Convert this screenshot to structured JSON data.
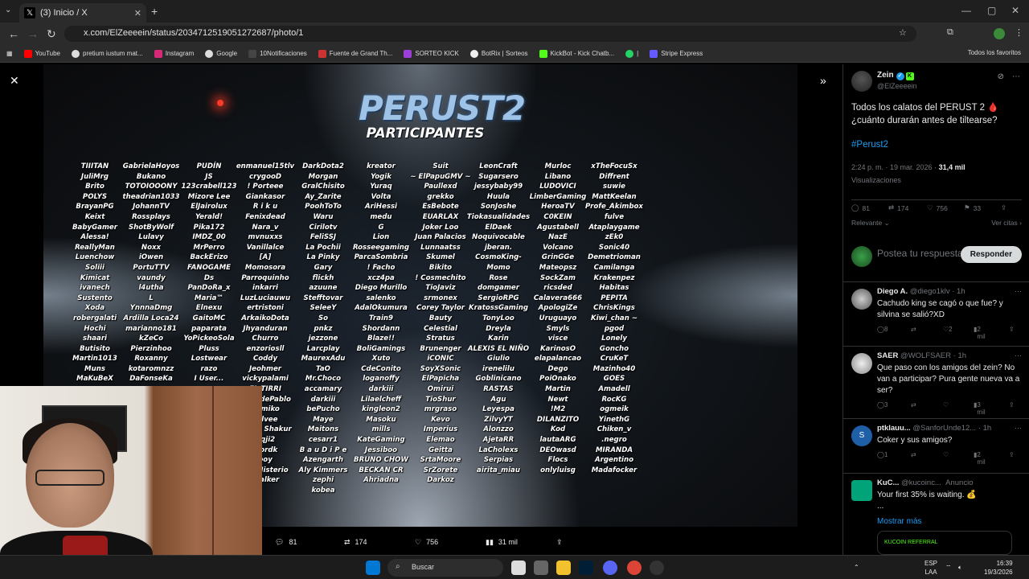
{
  "browser": {
    "tab_title": "(3) Inicio / X",
    "url": "x.com/ElZeeeein/status/2034712519051272687/photo/1",
    "bookmarks": [
      "YouTube",
      "pretium iustum mat...",
      "Instagram",
      "Google",
      "10Notificaciones",
      "Fuente de Grand Th...",
      "SORTEO KICK",
      "BotRix | Sorteos",
      "KickBot - Kick Chatb...",
      "|",
      "Stripe Express"
    ],
    "bookmarks_right": "Todos los favoritos"
  },
  "poster": {
    "title": "PERUST2",
    "subtitle": "PARTICIPANTES",
    "columns": [
      [
        "TIIITAN",
        "JuliMrg",
        "Brito",
        "POLYS",
        "BrayanPG",
        "Keixt",
        "BabyGamer",
        "Alessa!",
        "ReallyMan",
        "Luenchow",
        "Soliii",
        "Kimicat",
        "ivanech",
        "Sustento",
        "Xoda",
        "robergalati",
        "Hochi",
        "shaari",
        "Butisito",
        "Martin1013",
        "Muns",
        "MaKuBeX"
      ],
      [
        "GabrielaHoyos",
        "Bukano",
        "TOTOIOOONY",
        "theadrian1033",
        "JohannTV",
        "Rossplays",
        "ShotByWolf",
        "Lulavy",
        "Noxx",
        "iOwen",
        "PortuTTV",
        "vaundy",
        "l4utha",
        "L",
        "YnnnaDmg",
        "Ardilla Loca24",
        "marianno181",
        "kZeCo",
        "Pierzinhoo",
        "Roxanny",
        "kotaromnzz",
        "DaFonseKa"
      ],
      [
        "PUDÍN",
        "JS",
        "123crabell123",
        "Mizore Lee",
        "ElJairolux",
        "Yerald!",
        "Pika172",
        "IMDZ_00",
        "MrPerro",
        "BackErizo",
        "FANOGAME",
        "Ds",
        "PanDoRa_x",
        "Maria™",
        "Elnexu",
        "GaitoMC",
        "paparata",
        "YoPickeoSola",
        "Pluss",
        "Lostwear",
        "razo",
        "I User..."
      ],
      [
        "enmanuel15tlv",
        "crygooD",
        "! Porteee",
        "Giankasor",
        "R i k u",
        "Fenixdead",
        "Nara_v",
        "mvnuxxs",
        "Vanillalce",
        "[A]",
        "Momosora",
        "Parroquinho",
        "inkarri",
        "LuzLuciauwu",
        "ertristoni",
        "ArkaikoDota",
        "Jhyanduran",
        "Churro",
        "enzoriosll",
        "Coddy",
        "Jeohmer",
        "vickypalami",
        "EL TIRRI",
        "DuendePablo",
        "Kumiko",
        "sylvee",
        "Bryan Shakur",
        "Pqji2",
        "xlordk",
        "boy",
        "ReyMisterio",
        "Stalker"
      ],
      [
        "DarkDota2",
        "Morgan",
        "GralChisito",
        "Ay_Zarite",
        "PoohToTo",
        "Waru",
        "Cirilotv",
        "FeliSSJ",
        "La Pochii",
        "La Pinky",
        "Gary",
        "flickh",
        "azuune",
        "Stefftovar",
        "SeleeY",
        "So",
        "pnkz",
        "jezzone",
        "Larcplay",
        "MaurexAdu",
        "TaO",
        "Mr.Choco",
        "accamary",
        "darkiii",
        "bePucho",
        "Maye",
        "Maitons",
        "cesarr1",
        "B a u D i P e",
        "Azengarth",
        "Aly Kimmers",
        "zephi",
        "kobea"
      ],
      [
        "kreator",
        "Yogik",
        "Yuraq",
        "Volta",
        "AriHessi",
        "medu",
        "G",
        "Lion",
        "Rosseegaming",
        "ParcaSombria",
        "! Facho",
        "xcz4pa",
        "Diego Murillo",
        "salenko",
        "AdalOkumura",
        "Train9",
        "Shordann",
        "Blaze!!",
        "BoliGamings",
        "Xuto",
        "CdeConito",
        "loganoffy",
        "darkiii",
        "Lilaelcheff",
        "kingleon2",
        "Masoku",
        "mills",
        "KateGaming",
        "Jessiboo",
        "BRUNO CHOW",
        "BECKAN CR",
        "Ahriadna"
      ],
      [
        "Suit",
        "~ ElPapuGMV ~",
        "Paullexd",
        "grekko",
        "EsBebote",
        "EUARLAX",
        "Joker Loo",
        "Juan Palacios",
        "Lunnaatss",
        "Skumel",
        "Bikito",
        "! Cosmechito",
        "TioJaviz",
        "srmonex",
        "Corey Taylor",
        "Bauty",
        "Celestial",
        "Stratus",
        "Brunenger",
        "iCONIC",
        "SoyXSonic",
        "ElPapicha",
        "Omirui",
        "TioShur",
        "mrgraso",
        "Kevo",
        "Imperius",
        "Elemao",
        "Geitta",
        "SrtaMoore",
        "SrZorete",
        "Darkoz"
      ],
      [
        "LeonCraft",
        "Sugarsero",
        "jessybaby99",
        "Huula",
        "SonJoshe",
        "Tiokasualidades",
        "ElDaek",
        "Noquivocable",
        "jberan.",
        "CosmoKing-",
        "Momo",
        "Rose",
        "domgamer",
        "SergioRPG",
        "KratossGaming",
        "TonyLoo",
        "Dreyla",
        "Karin",
        "ALEXIS EL NIÑO",
        "Giulio",
        "irenelilu",
        "Goblinicano",
        "RASTAS",
        "Agu",
        "Leyespa",
        "ZilvyYT",
        "Alonzzo",
        "AjetaRR",
        "LaCholexs",
        "Serpias",
        "airita_miau"
      ],
      [
        "Murloc",
        "Libano",
        "LUDOVICI",
        "LimberGaming",
        "HeroaTV",
        "C0KEIN",
        "Agustabell",
        "NazE",
        "Volcano",
        "GrinGGe",
        "Mateopsz",
        "SockZam",
        "ricsded",
        "Calavera666",
        "ApologiZe",
        "Uruguayo",
        "Smyls",
        "visce",
        "KarinosO",
        "elapalancao",
        "Dego",
        "PoiOnako",
        "Martin",
        "Newt",
        "!M2",
        "DILANZITO",
        "Kod",
        "lautaARG",
        "DEOwasd",
        "Flocs",
        "onlyluisg"
      ],
      [
        "xTheFocuSx",
        "Diffrent",
        "suwie",
        "MattKeelan",
        "Profe_Akimbox",
        "fulve",
        "Ataplaygame",
        "zEk0",
        "Sonic40",
        "Demetrioman",
        "Camilanga",
        "Krakenpez",
        "Habitas",
        "PEPITA",
        "ChrisKings",
        "Kiwi_chan ~",
        "pgod",
        "Lonely",
        "Goncho",
        "CruKeT",
        "Mazinho40",
        "GOES",
        "Amadell",
        "RocKG",
        "ogmeik",
        "YinethG",
        "Chiken_v",
        ".negro",
        "MIRANDA",
        "Argentino",
        "Madafocker"
      ]
    ]
  },
  "media_actions": {
    "replies": "81",
    "reposts": "174",
    "likes": "756",
    "views": "31 mil"
  },
  "tweet": {
    "author_name": "Zein",
    "author_handle": "@ElZeeeein",
    "text": "Todos los calatos del PERUST 2 🩸 ¿cuánto durarán antes de tiltearse?",
    "hashtag": "#Perust2",
    "time": "2:24 p. m. · 19 mar. 2026 · ",
    "views_count": "31,4 mil",
    "views_label": "Visualizaciones",
    "stats": {
      "replies": "81",
      "reposts": "174",
      "likes": "756",
      "bookmarks": "33"
    },
    "sort_label": "Relevante",
    "quotes_label": "Ver citas",
    "reply_placeholder": "Postea tu respuesta",
    "reply_button": "Responder"
  },
  "comments": [
    {
      "name": "Diego A.",
      "meta": "@diego1klv · 1h",
      "text": "Cachudo king se cagó o que fue? y silvina se salió?XD",
      "replies": "8",
      "reposts": "",
      "likes": "2",
      "views": "2 mil"
    },
    {
      "name": "SAER",
      "meta": "@WOLFSAER · 1h",
      "text": "Que paso con los amigos del zein? No van a participar? Pura gente nueva va a ser?",
      "replies": "3",
      "reposts": "",
      "likes": "",
      "views": "3 mil"
    },
    {
      "name": "ptklauu...",
      "meta": "@SanforUnde12... · 1h",
      "text": "Coker y sus amigos?",
      "replies": "1",
      "reposts": "",
      "likes": "",
      "views": "2 mil"
    }
  ],
  "promo": {
    "name": "KuC...",
    "handle": "@kucoinc...",
    "label": "Anuncio",
    "text": "Your first 35% is waiting. 💰",
    "ellipsis": "...",
    "link": "Mostrar más",
    "card": "KUCOIN REFERRAL"
  },
  "taskbar": {
    "search": "Buscar",
    "lang_top": "ESP",
    "lang_bottom": "LAA",
    "time": "16:39",
    "date": "19/3/2026"
  }
}
